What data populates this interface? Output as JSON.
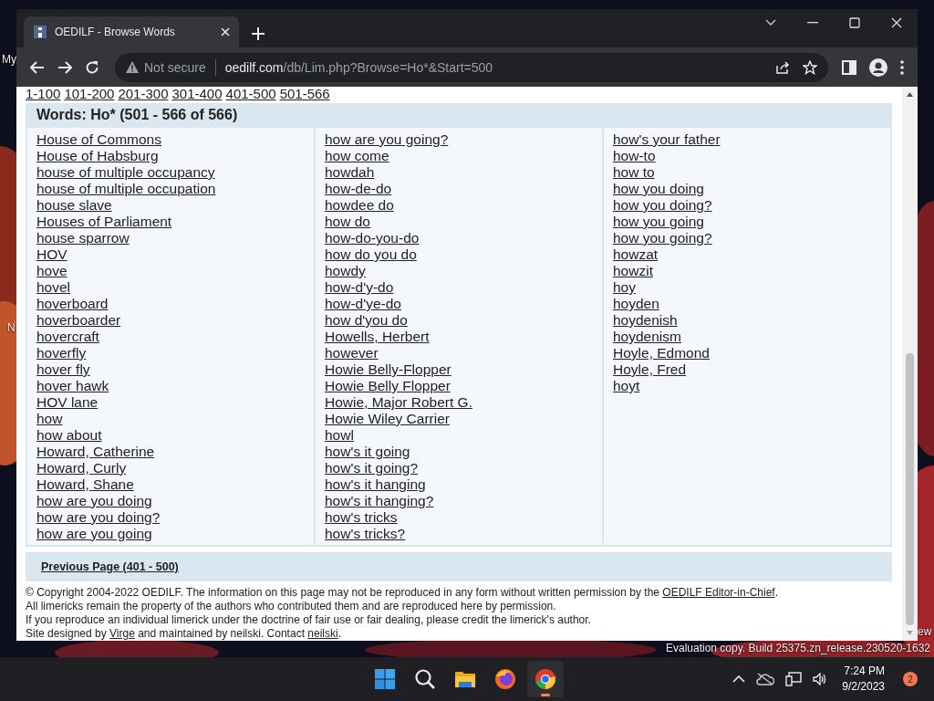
{
  "browser": {
    "tab": {
      "title": "OEDILF - Browse Words",
      "selected": true
    },
    "address": {
      "security": "Not secure",
      "domain": "oedilf.com",
      "path": "/db/Lim.php?Browse=Ho*&Start=500"
    }
  },
  "page": {
    "range_links": [
      "1-100",
      "101-200",
      "201-300",
      "301-400",
      "401-500",
      "501-566"
    ],
    "heading": "Words: Ho* (501 - 566 of 566)",
    "columns": [
      [
        "House of Commons",
        "House of Habsburg",
        "house of multiple occupancy",
        "house of multiple occupation",
        "house slave",
        "Houses of Parliament",
        "house sparrow",
        "HOV",
        "hove",
        "hovel",
        "hoverboard",
        "hoverboarder",
        "hovercraft",
        "hoverfly",
        "hover fly",
        "hover hawk",
        "HOV lane",
        "how",
        "how about",
        "Howard, Catherine",
        "Howard, Curly",
        "Howard, Shane",
        "how are you doing",
        "how are you doing?",
        "how are you going"
      ],
      [
        "how are you going?",
        "how come",
        "howdah",
        "how-de-do",
        "howdee do",
        "how do",
        "how-do-you-do",
        "how do you do",
        "howdy",
        "how-d'y-do",
        "how-d'ye-do",
        "how d'you do",
        "Howells, Herbert",
        "however",
        "Howie Belly-Flopper",
        "Howie Belly Flopper",
        "Howie, Major Robert G.",
        "Howie Wiley Carrier",
        "howl",
        "how's it going",
        "how's it going?",
        "how's it hanging",
        "how's it hanging?",
        "how's tricks",
        "how's tricks?"
      ],
      [
        "how's your father",
        "how-to",
        "how to",
        "how you doing",
        "how you doing?",
        "how you going",
        "how you going?",
        "howzat",
        "howzit",
        "hoy",
        "hoyden",
        "hoydenish",
        "hoydenism",
        "Hoyle, Edmond",
        "Hoyle, Fred",
        "hoyt"
      ]
    ],
    "previous_page": "Previous Page (401 - 500)",
    "footer": [
      [
        {
          "text": "© Copyright 2004-2022 OEDILF. The information on this page may not be reproduced in any form without written permission by the "
        },
        {
          "text": "OEDILF Editor-in-Chief",
          "link": true
        },
        {
          "text": "."
        }
      ],
      [
        {
          "text": "All limericks remain the property of the authors who contributed them and are reproduced here by permission."
        }
      ],
      [
        {
          "text": "If you reproduce an individual limerick under the doctrine of fair use or fair dealing, please credit the limerick's author."
        }
      ],
      [
        {
          "text": "Site designed by "
        },
        {
          "text": "Virge",
          "link": true
        },
        {
          "text": " and maintained by neilski. Contact "
        },
        {
          "text": "neilski",
          "link": true
        },
        {
          "text": "."
        }
      ]
    ]
  },
  "desktop": {
    "labels": [
      "My",
      "N",
      "ew"
    ],
    "build_note": "Evaluation copy. Build 25375.zn_release.230520-1632"
  },
  "taskbar": {
    "apps": [
      {
        "kind": "start",
        "selected": false
      },
      {
        "kind": "search",
        "selected": false
      },
      {
        "kind": "files",
        "selected": false
      },
      {
        "kind": "firefox",
        "selected": false
      },
      {
        "kind": "chrome",
        "selected": true
      }
    ],
    "clock": {
      "time": "7:24 PM",
      "date": "9/2/2023"
    },
    "notification_count": "2"
  }
}
